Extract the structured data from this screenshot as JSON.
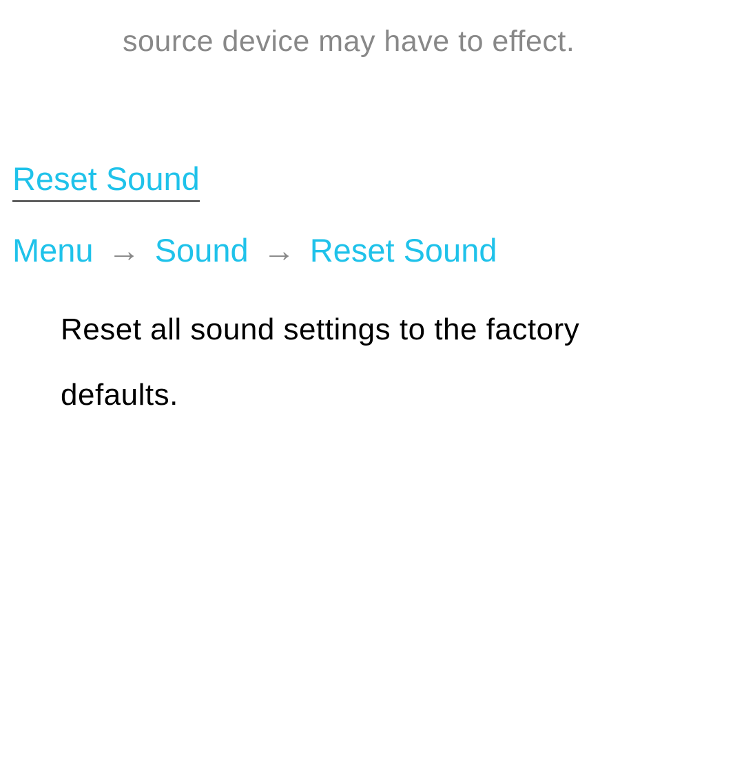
{
  "fragment_text": "source device may have to effect.",
  "section": {
    "heading": "Reset Sound",
    "breadcrumb": {
      "item1": "Menu",
      "item2": "Sound",
      "item3": "Reset Sound"
    },
    "description": "Reset all sound settings to the factory defaults."
  }
}
